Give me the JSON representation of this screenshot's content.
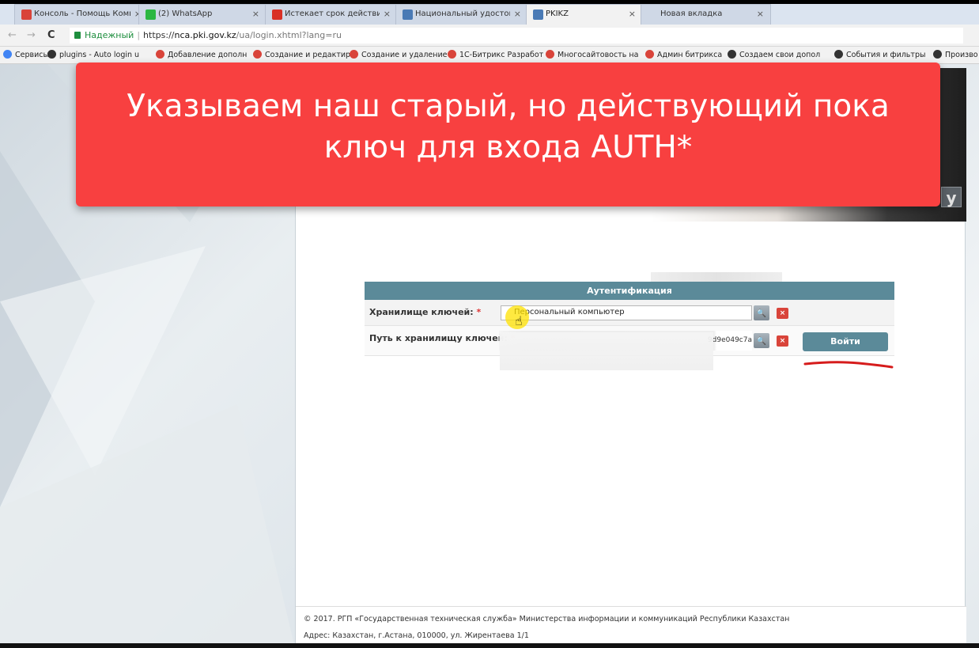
{
  "browser": {
    "tabs": [
      {
        "title": "Консоль - Помощь Комп",
        "favicon_color": "#d9443a",
        "active": false
      },
      {
        "title": "(2) WhatsApp",
        "favicon_color": "#2bb741",
        "active": false
      },
      {
        "title": "Истекает срок действия",
        "favicon_color": "#d93025",
        "active": false
      },
      {
        "title": "Национальный удостов",
        "favicon_color": "#4a7ab5",
        "active": false
      },
      {
        "title": "PKIKZ",
        "favicon_color": "#4a7ab5",
        "active": true
      },
      {
        "title": "Новая вкладка",
        "favicon_color": "",
        "active": false
      }
    ],
    "close_glyph": "×",
    "nav": {
      "back": "←",
      "forward": "→",
      "reload": "C"
    },
    "address": {
      "secure_label": "Надежный",
      "url_scheme": "https://",
      "url_host": "nca.pki.gov.kz",
      "url_path": "/ua/login.xhtml?lang=ru"
    },
    "bookmarks": [
      {
        "label": "Сервисы",
        "icon": "apps-grid-icon",
        "color": "#4285f4"
      },
      {
        "label": "plugins - Auto login u",
        "icon": "wordpress-w-icon",
        "color": "#333333"
      },
      {
        "label": "Добавление дополн",
        "icon": "bitrix-icon",
        "color": "#d9443a"
      },
      {
        "label": "Создание и редактир",
        "icon": "bitrix-icon",
        "color": "#d9443a"
      },
      {
        "label": "Создание и удаление",
        "icon": "bitrix-icon",
        "color": "#d9443a"
      },
      {
        "label": "1С-Битрикс Разработ",
        "icon": "bitrix-icon",
        "color": "#d9443a"
      },
      {
        "label": "Многосайтовость на",
        "icon": "bitrix-icon",
        "color": "#d9443a"
      },
      {
        "label": "Админ битрикса",
        "icon": "bitrix-icon",
        "color": "#d9443a"
      },
      {
        "label": "Создаем свои допол",
        "icon": "ex-icon",
        "color": "#333333"
      },
      {
        "label": "События и фильтры",
        "icon": "wp-icon",
        "color": "#333333"
      },
      {
        "label": "Произво",
        "icon": "wordpress-w-icon",
        "color": "#333333"
      }
    ]
  },
  "overlay": {
    "line1": "Указываем наш старый, но действующий пока",
    "line2": "ключ для входа AUTH*",
    "color": "#f84040"
  },
  "banner": {
    "letter": "y"
  },
  "auth": {
    "header": "Аутентификация",
    "storage_label": "Хранилище ключей:",
    "required_mark": "*",
    "storage_value": "Персональный компьютер",
    "path_label": "Путь к хранилищу ключей:",
    "path_value": "9d9e049c7a",
    "login_button": "Войти",
    "search_glyph": "🔍",
    "clear_glyph": "×",
    "accent_color": "#5b8a99"
  },
  "footer": {
    "copyright": "© 2017. РГП «Государственная техническая служба» Министерства информации и коммуникаций Республики Казахстан",
    "address": "Адрес: Казахстан, г.Астана, 010000, ул. Жирентаева 1/1"
  }
}
